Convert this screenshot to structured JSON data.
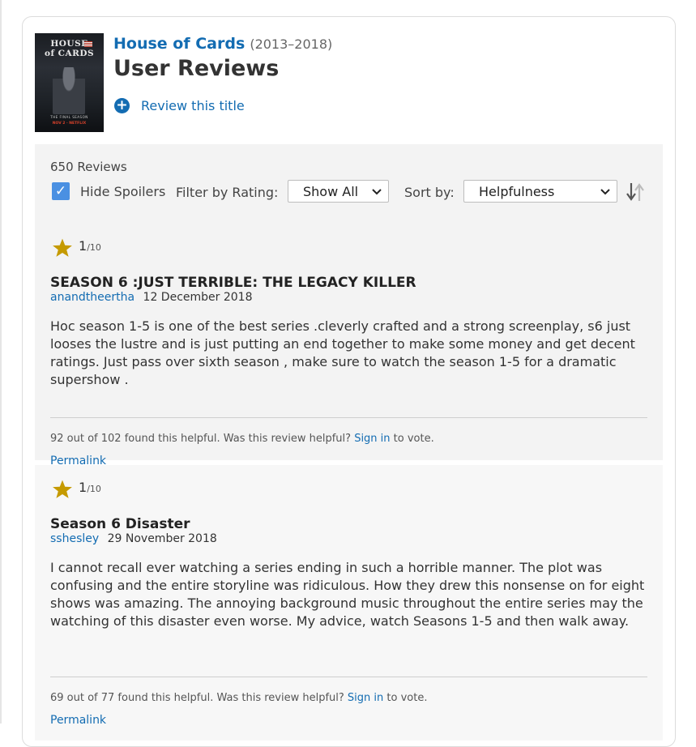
{
  "show": {
    "title": "House of Cards",
    "years": "(2013–2018)"
  },
  "page_title": "User Reviews",
  "review_link_label": "Review this title",
  "poster": {
    "title_line1": "HOUSE",
    "title_line2": "of CARDS",
    "subtitle": "THE FINAL SEASON",
    "brand": "NOV 2 · NETFLIX"
  },
  "filters": {
    "count_text": "650 Reviews",
    "hide_spoilers_label": "Hide Spoilers",
    "hide_spoilers_checked": true,
    "rating_label": "Filter by Rating:",
    "rating_value": "Show All",
    "sort_label": "Sort by:",
    "sort_value": "Helpfulness"
  },
  "reviews": [
    {
      "rating": "1",
      "rating_scale": "/10",
      "title": "SEASON 6 :JUST TERRIBLE: THE LEGACY KILLER",
      "author": "anandtheertha",
      "date": "12 December 2018",
      "body": "Hoc season 1-5 is one of the best series .cleverly crafted and a strong screenplay, s6 just looses the lustre and is just putting an end together to make some money and get decent ratings. Just pass over sixth season , make sure to watch the season 1-5 for a dramatic supershow .",
      "helpful_text": "92 out of 102 found this helpful. Was this review helpful? ",
      "sign_in": "Sign in",
      "vote_text": " to vote.",
      "permalink": "Permalink"
    },
    {
      "rating": "1",
      "rating_scale": "/10",
      "title": "Season 6 Disaster",
      "author": "sshesley",
      "date": "29 November 2018",
      "body": "I cannot recall ever watching a series ending in such a horrible manner. The plot was confusing and the entire storyline was ridiculous. How they drew this nonsense on for eight shows was amazing. The annoying background music throughout the entire series may the watching of this disaster even worse. My advice, watch Seasons 1-5 and then walk away.",
      "helpful_text": "69 out of 77 found this helpful. Was this review helpful? ",
      "sign_in": "Sign in",
      "vote_text": " to vote.",
      "permalink": "Permalink"
    }
  ],
  "colors": {
    "link": "#136cb2",
    "star": "#c59a00",
    "checkbox": "#4a90e2"
  }
}
